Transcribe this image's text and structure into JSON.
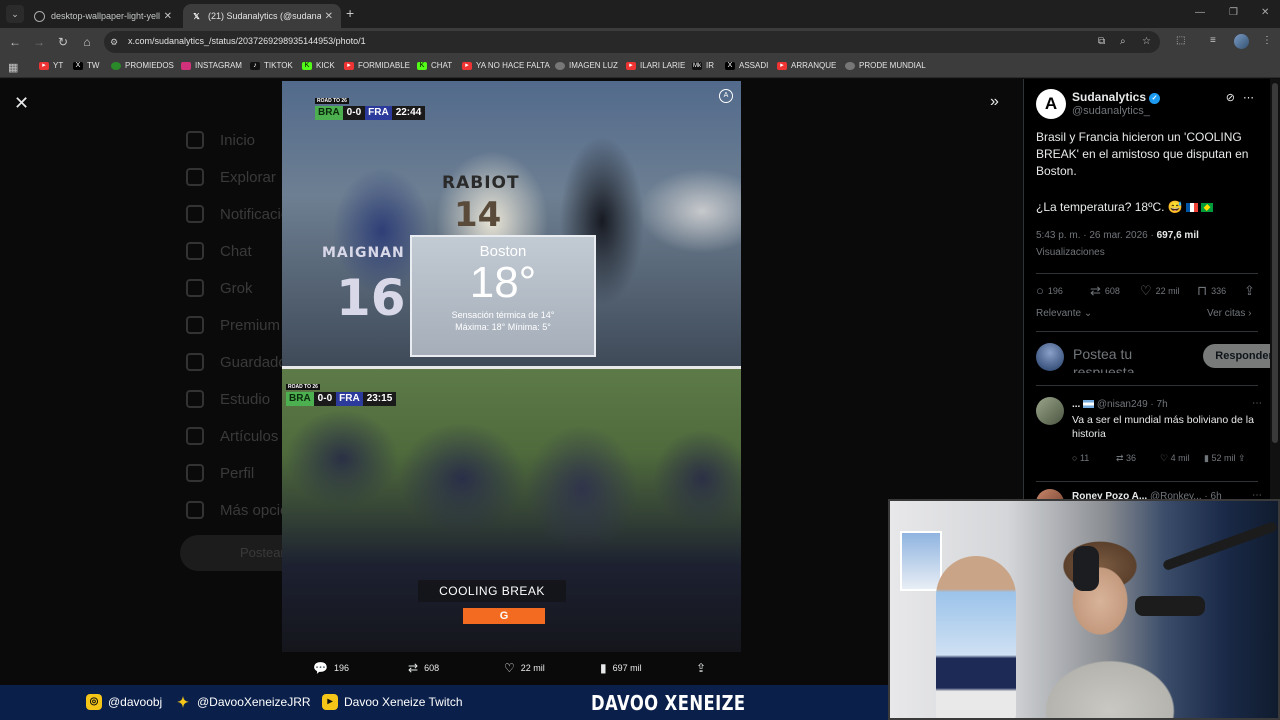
{
  "browser": {
    "tabs": [
      {
        "label": "desktop-wallpaper-light-yellow",
        "active": false
      },
      {
        "label": "(21) Sudanalytics (@sudanalytics",
        "active": true
      }
    ],
    "url": "x.com/sudanalytics_/status/2037269298935144953/photo/1",
    "bookmarks": [
      "YT",
      "TW",
      "PROMIEDOS",
      "INSTAGRAM",
      "TIKTOK",
      "KICK",
      "FORMIDABLE",
      "CHAT",
      "YA NO HACE FALTA",
      "IMAGEN LUZ",
      "ILARI LARIE",
      "IR",
      "ASSADI",
      "ARRANQUE",
      "PRODE MUNDIAL"
    ]
  },
  "background_nav": [
    "Inicio",
    "Explorar",
    "Notificaciones",
    "Chat",
    "Grok",
    "Premium",
    "Guardados",
    "Estudio",
    "Artículos",
    "Perfil",
    "Más opciones"
  ],
  "background_post_label": "Postear",
  "media": {
    "top": {
      "broadcast": "ROAD TO 26",
      "home": "BRA",
      "score": "0-0",
      "away": "FRA",
      "clock": "22:44",
      "jersey_name_1": "RABIOT",
      "jersey_num_1": "14",
      "jersey_name_2": "MAIGNAN",
      "jersey_num_2": "16",
      "weather": {
        "city": "Boston",
        "temp": "18°",
        "feels": "Sensación térmica de 14°",
        "minmax": "Máxima: 18°  Mínima: 5°"
      }
    },
    "bottom": {
      "broadcast": "ROAD TO 26",
      "home": "BRA",
      "score": "0-0",
      "away": "FRA",
      "clock": "23:15",
      "caption": "COOLING BREAK",
      "sponsor": "G"
    },
    "actions": {
      "replies": "196",
      "reposts": "608",
      "likes": "22 mil",
      "views": "697 mil"
    }
  },
  "tweet": {
    "name": "Sudanalytics",
    "handle": "@sudanalytics_",
    "text": "Brasil y Francia hicieron un 'COOLING BREAK' en el amistoso que disputan en Boston.",
    "text2": "¿La temperatura? 18ºC. 😅",
    "time": "5:43 p. m. · 26 mar. 2026 · ",
    "views_count": "697,6 mil",
    "views_label": "Visualizaciones",
    "stats": {
      "replies": "196",
      "reposts": "608",
      "likes": "22 mil",
      "bookmarks": "336"
    },
    "sort_label": "Relevante",
    "quotes_label": "Ver citas",
    "reply_placeholder": "Postea tu respuesta",
    "reply_button": "Responder"
  },
  "replies": [
    {
      "name": "...",
      "handle": "@nisan249 · 7h",
      "text": "Va a ser el mundial más boliviano de la historia",
      "stats": {
        "replies": "11",
        "reposts": "36",
        "likes": "4 mil",
        "views": "52 mil"
      }
    },
    {
      "name": "Roney Pozo A...",
      "handle": "@Ronkey... · 6h"
    }
  ],
  "stream_bar": {
    "instagram": "@davoobj",
    "twitter": "@DavooXeneizeJRR",
    "youtube": "Davoo Xeneize Twitch",
    "brand": "DAVOO XENEIZE"
  },
  "colors": {
    "x_blue": "#1d9bf0",
    "stream_bar": "#0a1f4a",
    "gatorade": "#f36b21"
  }
}
